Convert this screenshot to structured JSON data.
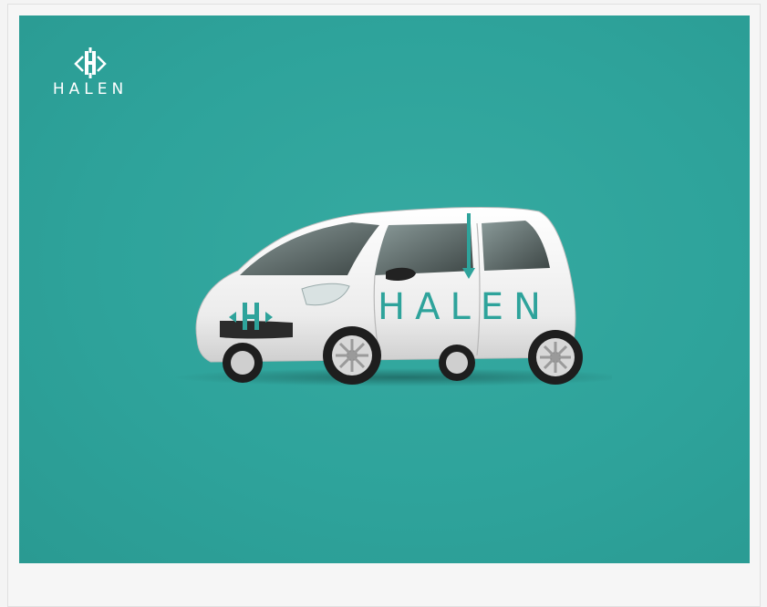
{
  "brand": {
    "logo_text": "HALEN",
    "car_text": "HALEN"
  },
  "colors": {
    "background_teal": "#2ea39b",
    "logo_white": "#ffffff",
    "car_body": "#f2f2f2"
  },
  "icons": {
    "logo_mark": "h-monogram-icon"
  }
}
